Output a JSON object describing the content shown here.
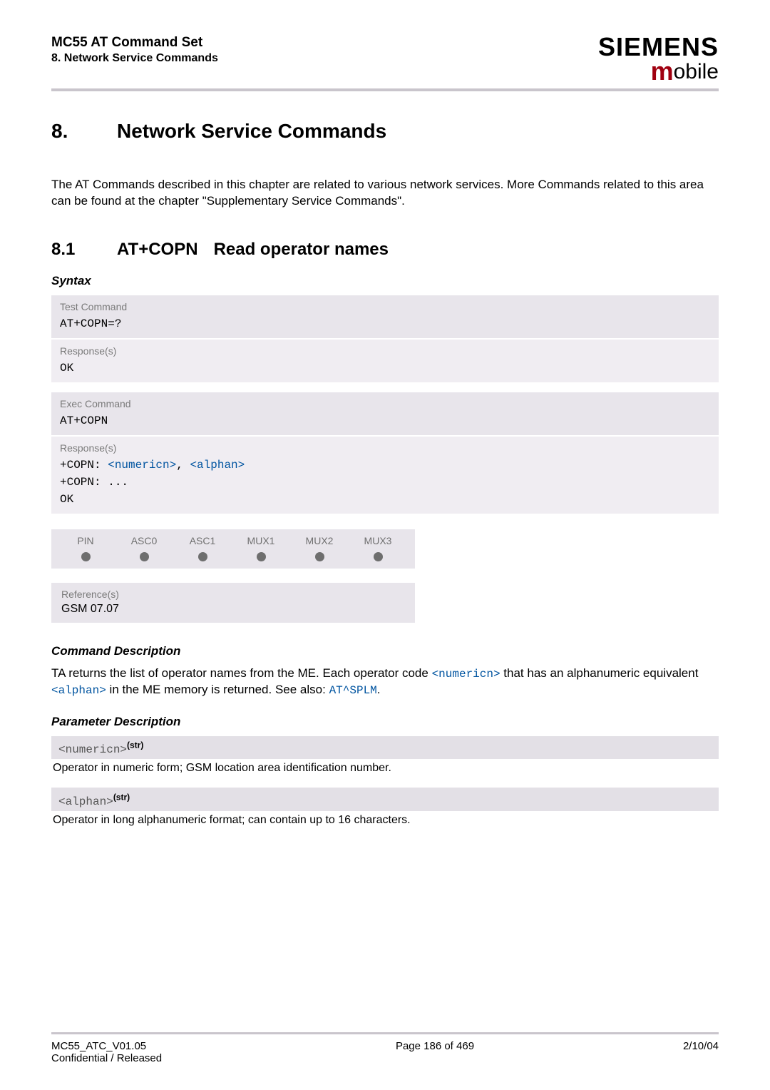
{
  "header": {
    "doc_title": "MC55 AT Command Set",
    "doc_subtitle": "8. Network Service Commands",
    "brand_top": "SIEMENS",
    "brand_bottom_rest": "obile"
  },
  "chapter": {
    "num": "8.",
    "title": "Network Service Commands"
  },
  "intro": "The AT Commands described in this chapter are related to various network services. More Commands related to this area can be found at the chapter \"Supplementary Service Commands\".",
  "section": {
    "num": "8.1",
    "cmd": "AT+COPN",
    "title": "Read operator names"
  },
  "syntax_label": "Syntax",
  "test_cmd": {
    "label": "Test Command",
    "cmd": "AT+COPN=?",
    "resp_label": "Response(s)",
    "resp": "OK"
  },
  "exec_cmd": {
    "label": "Exec Command",
    "cmd": "AT+COPN",
    "resp_label": "Response(s)",
    "resp_prefix": "+COPN: ",
    "p1": "<numericn>",
    "comma": ", ",
    "p2": "<alphan>",
    "resp_cont": "+COPN: ...",
    "resp_ok": "OK"
  },
  "pin_row": {
    "c0": "PIN",
    "c1": "ASC0",
    "c2": "ASC1",
    "c3": "MUX1",
    "c4": "MUX2",
    "c5": "MUX3"
  },
  "reference": {
    "label": "Reference(s)",
    "value": "GSM 07.07"
  },
  "cmd_desc": {
    "heading": "Command Description",
    "p1a": "TA returns the list of operator names from the ME. Each operator code ",
    "p1_param1": "<numericn>",
    "p1b": " that has an alphanumeric equivalent ",
    "p1_param2": "<alphan>",
    "p1c": " in the ME memory is returned. See also: ",
    "p1_link": "AT^SPLM",
    "p1d": "."
  },
  "param_desc": {
    "heading": "Parameter Description",
    "p1_code": "<numericn>",
    "sup": "(str)",
    "p1_desc": "Operator in numeric form; GSM location area identification number.",
    "p2_code": "<alphan>",
    "p2_desc": "Operator in long alphanumeric format; can contain up to 16 characters."
  },
  "footer": {
    "left1": "MC55_ATC_V01.05",
    "left2": "Confidential / Released",
    "mid": "Page 186 of 469",
    "right": "2/10/04"
  }
}
